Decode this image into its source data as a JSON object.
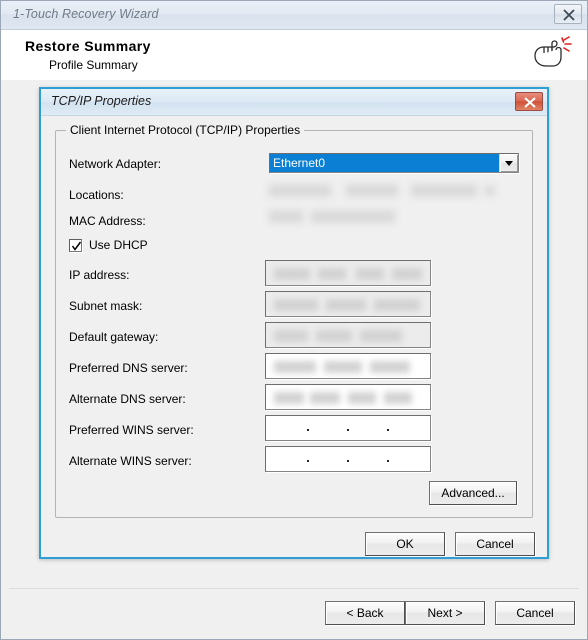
{
  "wizard": {
    "title": "1-Touch Recovery Wizard",
    "close_icon": "close-icon",
    "header": {
      "title": "Restore Summary",
      "subtitle": "Profile Summary",
      "icon": "pointing-hand-click-icon"
    },
    "footer_buttons": [
      {
        "name": "back",
        "label": "< Back"
      },
      {
        "name": "next",
        "label": "Next >"
      },
      {
        "name": "cancel",
        "label": "Cancel"
      }
    ]
  },
  "dialog": {
    "title": "TCP/IP Properties",
    "close_icon": "close-icon",
    "groupbox_label": "Client Internet Protocol (TCP/IP) Properties",
    "network_adapter": {
      "label": "Network Adapter:",
      "value": "Ethernet0",
      "arrow_icon": "chevron-down-icon"
    },
    "locations": {
      "label": "Locations:",
      "value": "",
      "redacted": true
    },
    "mac_address": {
      "label": "MAC Address:",
      "value": "",
      "redacted": true
    },
    "use_dhcp": {
      "label": "Use DHCP",
      "checked": true,
      "check_icon": "checkmark-icon"
    },
    "fields": [
      {
        "name": "ip-address",
        "label": "IP address:",
        "value": "",
        "redacted": true,
        "disabled": true
      },
      {
        "name": "subnet-mask",
        "label": "Subnet mask:",
        "value": "",
        "redacted": true,
        "disabled": true
      },
      {
        "name": "default-gateway",
        "label": "Default gateway:",
        "value": "",
        "redacted": true,
        "disabled": true
      },
      {
        "name": "preferred-dns-server",
        "label": "Preferred DNS server:",
        "value": "",
        "redacted": true,
        "disabled": false
      },
      {
        "name": "alternate-dns-server",
        "label": "Alternate DNS server:",
        "value": "",
        "redacted": true,
        "disabled": false
      },
      {
        "name": "preferred-wins-server",
        "label": "Preferred WINS server:",
        "value": "",
        "redacted": false,
        "disabled": false
      },
      {
        "name": "alternate-wins-server",
        "label": "Alternate WINS server:",
        "value": "",
        "redacted": false,
        "disabled": false
      }
    ],
    "advanced_button": "Advanced...",
    "ok_button": "OK",
    "cancel_button": "Cancel"
  },
  "colors": {
    "dialog_border": "#2e9fd4",
    "combo_highlight": "#0b7fd4",
    "close_red": "#cf5138",
    "window_bg": "#f0f0f0"
  }
}
